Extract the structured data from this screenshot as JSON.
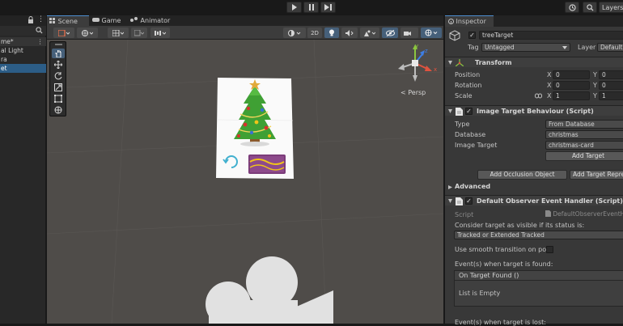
{
  "toolbar": {
    "play_icon": "play-icon",
    "pause_icon": "pause-icon",
    "step_icon": "step-icon",
    "history_icon": "history-icon",
    "search_icon": "search-icon",
    "layers_label": "Layers"
  },
  "hierarchy": {
    "more_glyph": "⋮",
    "scene_label": "me*",
    "items": [
      {
        "label": "al Light"
      },
      {
        "label": "ra"
      },
      {
        "label": "et"
      }
    ]
  },
  "scene_tabs": [
    {
      "label": "Scene"
    },
    {
      "label": "Game"
    },
    {
      "label": "Animator"
    }
  ],
  "scene_toolbar": {
    "mode_2d": "2D"
  },
  "viewport": {
    "persp_label": "< Persp",
    "axis_labels": {
      "y": "y",
      "x": "x",
      "z": "z"
    }
  },
  "inspector": {
    "tab_label": "Inspector",
    "object_name": "treeTarget",
    "tag_label": "Tag",
    "tag_value": "Untagged",
    "layer_label": "Layer",
    "layer_value": "Default",
    "transform": {
      "title": "Transform",
      "rows": [
        {
          "label": "Position",
          "x": "0",
          "y": "0"
        },
        {
          "label": "Rotation",
          "x": "0",
          "y": "0"
        },
        {
          "label": "Scale",
          "x": "1",
          "y": "1"
        }
      ],
      "axis_x": "X",
      "axis_y": "Y"
    },
    "image_target": {
      "title": "Image Target Behaviour (Script)",
      "rows": [
        {
          "label": "Type",
          "value": "From Database"
        },
        {
          "label": "Database",
          "value": "christmas"
        },
        {
          "label": "Image Target",
          "value": "christmas-card"
        }
      ],
      "add_target": "Add Target",
      "add_occlusion": "Add Occlusion Object",
      "add_target_repr": "Add Target Repre",
      "advanced": "Advanced"
    },
    "observer": {
      "title": "Default Observer Event Handler (Script)",
      "script_label": "Script",
      "script_value": "DefaultObserverEventH",
      "consider_label": "Consider target as visible if its status is:",
      "status_value": "Tracked or Extended Tracked",
      "smooth_label": "Use smooth transition on pose",
      "found_label": "Event(s) when target is found:",
      "on_found": "On Target Found ()",
      "list_empty": "List is Empty",
      "lost_label": "Event(s) when target is lost:"
    }
  }
}
